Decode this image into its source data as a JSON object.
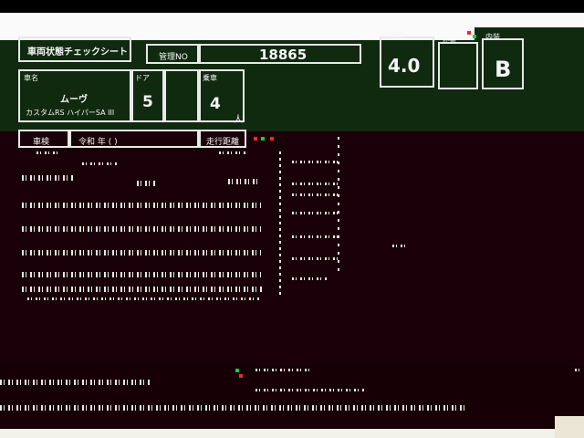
{
  "sheet": {
    "title": "車両状態チェックシート",
    "mgmt_no_label": "管理NO",
    "mgmt_no": "18865",
    "score_label": "評価点",
    "score": "4.0",
    "exterior_label": "外装",
    "interior_label": "内装",
    "interior_grade": "B",
    "model_label": "車名",
    "model_name": "ムーヴ",
    "model_sub": "カスタムRS ハイパーSA III",
    "doors_label": "ドア",
    "doors": "5",
    "seats_label": "乗車",
    "seats": "4",
    "seats_unit": "人",
    "row_label_1": "車検",
    "row_label_2": "令和 年 (  )",
    "row_label_3": "走行距離",
    "bracket": ")"
  }
}
